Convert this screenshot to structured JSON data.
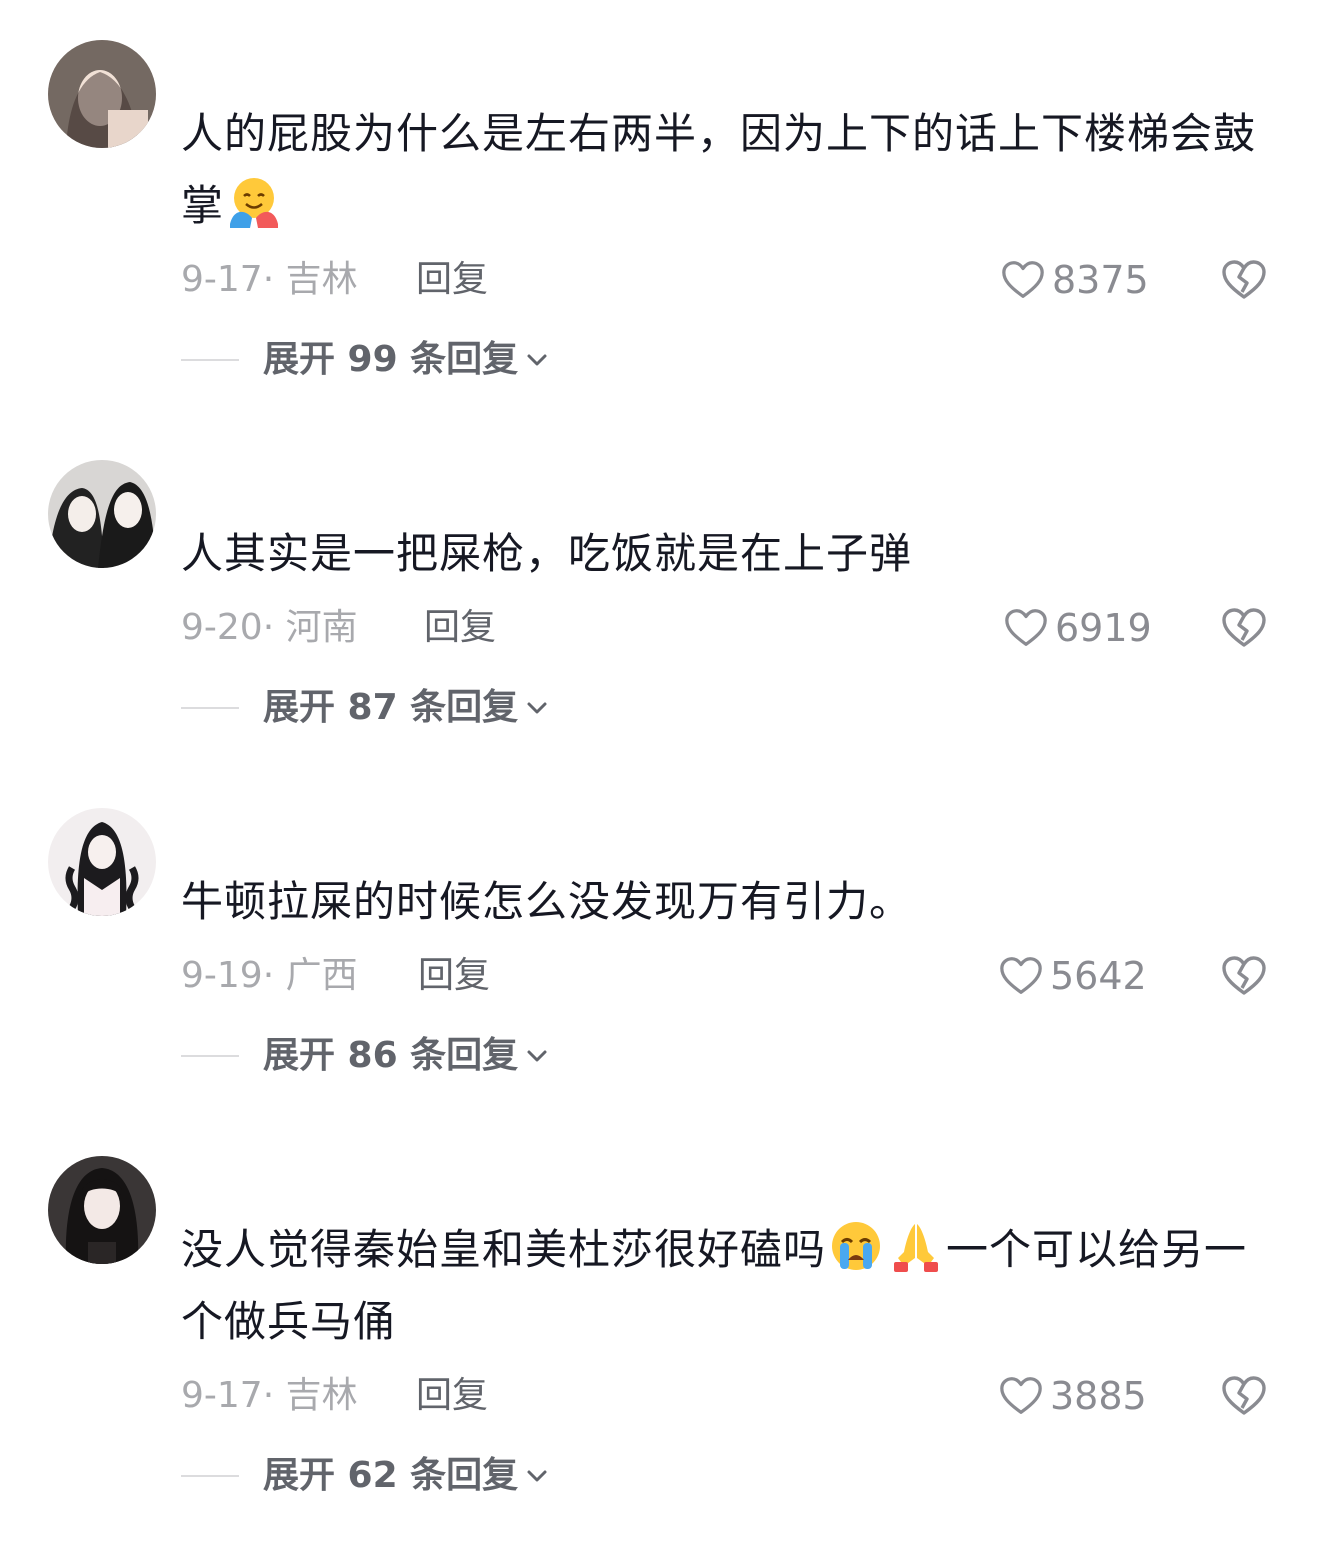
{
  "comments": [
    {
      "text": "人的屁股为什么是左右两半，因为上下的话上下楼梯会鼓掌",
      "emojis": [
        "hugging-face-emoji"
      ],
      "date": "9-17",
      "location": "吉林",
      "date_location": "9-17· 吉林",
      "reply_label": "回复",
      "likes": "8375",
      "expand_label": "展开 99 条回复"
    },
    {
      "text": "人其实是一把屎枪，吃饭就是在上子弹",
      "emojis": [],
      "date": "9-20",
      "location": "河南",
      "date_location": "9-20· 河南",
      "reply_label": "回复",
      "likes": "6919",
      "expand_label": "展开 87 条回复"
    },
    {
      "text": "牛顿拉屎的时候怎么没发现万有引力。",
      "emojis": [],
      "date": "9-19",
      "location": "广西",
      "date_location": "9-19· 广西",
      "reply_label": "回复",
      "likes": "5642",
      "expand_label": "展开 86 条回复"
    },
    {
      "text_before": "没人觉得秦始皇和美杜莎很好磕吗",
      "text_after": "一个可以给另一个做兵马俑",
      "emojis": [
        "loudly-crying-face-emoji",
        "folded-hands-emoji"
      ],
      "date": "9-17",
      "location": "吉林",
      "date_location": "9-17· 吉林",
      "reply_label": "回复",
      "likes": "3885",
      "expand_label": "展开 62 条回复"
    }
  ],
  "icons": {
    "like": "heart-outline-icon",
    "dislike": "broken-heart-icon",
    "expand": "chevron-down-icon"
  },
  "colors": {
    "text": "#161823",
    "meta": "#a8a9ad",
    "action": "#61646b",
    "icon": "#8a8b91"
  }
}
